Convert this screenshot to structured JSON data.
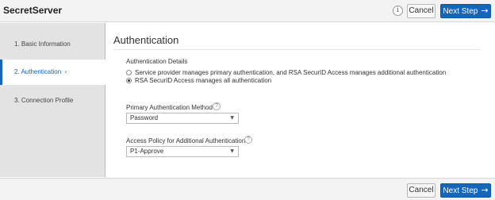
{
  "header": {
    "app_title": "SecretServer",
    "info_icon": "i",
    "cancel_label": "Cancel",
    "next_label": "Next Step",
    "next_arrow": "→"
  },
  "sidebar": {
    "items": [
      {
        "label": "1. Basic Information",
        "active": false
      },
      {
        "label": "2. Authentication",
        "active": true,
        "chevron": "›"
      },
      {
        "label": "3. Connection Profile",
        "active": false
      }
    ]
  },
  "main": {
    "title": "Authentication",
    "auth_details": {
      "label": "Authentication Details",
      "options": [
        {
          "label": "Service provider manages primary authentication, and RSA SecurID Access manages additional authentication",
          "selected": false
        },
        {
          "label": "RSA SecurID Access manages all authentication",
          "selected": true
        }
      ]
    },
    "primary_method": {
      "label": "Primary Authentication Method",
      "help": "?",
      "value": "Password",
      "caret": "▼"
    },
    "access_policy": {
      "label": "Access Policy for Additional Authentication",
      "help": "?",
      "value": "P1-Approve",
      "caret": "▼"
    }
  },
  "footer": {
    "cancel_label": "Cancel",
    "next_label": "Next Step",
    "next_arrow": "→"
  },
  "colors": {
    "accent": "#1565b8",
    "sidebar_bg": "#e3e3e3",
    "bar_bg": "#f3f3f3"
  }
}
